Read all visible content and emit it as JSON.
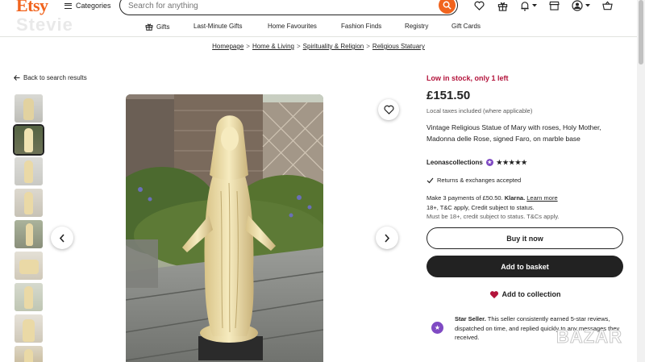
{
  "header": {
    "logo": "Etsy",
    "categories_label": "Categories",
    "search_placeholder": "Search for anything"
  },
  "watermarks": {
    "top_left": "Stevie",
    "bottom_right": "BAZAR"
  },
  "nav": [
    {
      "label": "Gifts",
      "icon": "gift-icon"
    },
    {
      "label": "Last-Minute Gifts"
    },
    {
      "label": "Home Favourites"
    },
    {
      "label": "Fashion Finds"
    },
    {
      "label": "Registry"
    },
    {
      "label": "Gift Cards"
    }
  ],
  "breadcrumb": [
    "Homepage",
    "Home & Living",
    "Spirituality & Religion",
    "Religious Statuary"
  ],
  "back_link": "Back to search results",
  "gallery": {
    "thumb_count": 9,
    "active_index": 1
  },
  "product": {
    "stock": "Low in stock, only 1 left",
    "price": "£151.50",
    "tax_note": "Local taxes included (where applicable)",
    "title": "Vintage Religious Statue of Mary with roses, Holy Mother, Madonna delle Rose, signed Faro, on marble base",
    "seller": "Leonascollections",
    "rating_stars": 5,
    "returns": "Returns & exchanges accepted",
    "klarna": {
      "line1": "Make 3 payments of £50.50.",
      "brand": "Klarna.",
      "link": "Learn more",
      "line2": "18+, T&C apply, Credit subject to status.",
      "line3": "Must be 18+, credit subject to status. T&Cs apply."
    },
    "buy_now": "Buy it now",
    "add_to_basket": "Add to basket",
    "add_to_collection": "Add to collection",
    "star_seller": {
      "title": "Star Seller.",
      "text": "This seller consistently earned 5-star reviews, dispatched on time, and replied quickly to any messages they received."
    }
  },
  "colors": {
    "brand": "#f1641e",
    "stock": "#b3133b",
    "star_seller": "#7f4ac3",
    "dark_button": "#222222",
    "favorite": "#b3133b"
  }
}
